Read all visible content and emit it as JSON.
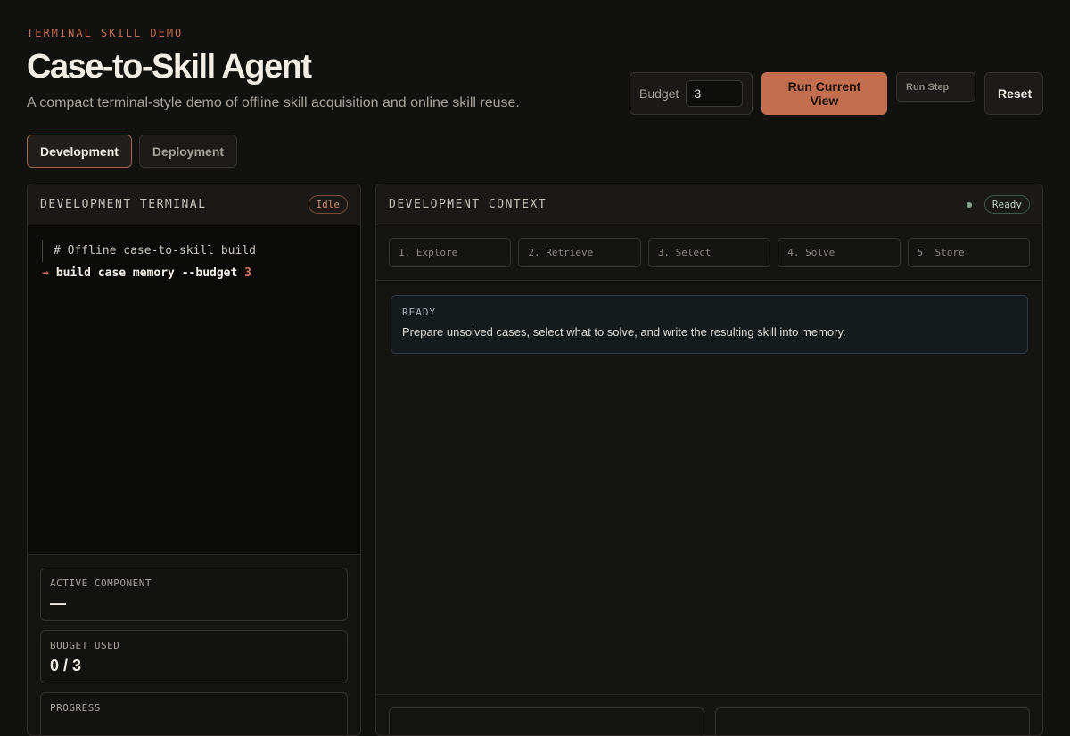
{
  "header": {
    "eyebrow": "TERMINAL SKILL DEMO",
    "title": "Case-to-Skill Agent",
    "subtitle": "A compact terminal-style demo of offline skill acquisition and online skill reuse."
  },
  "controls": {
    "budget_label": "Budget",
    "budget_value": "3",
    "run_view_label": "Run Current View",
    "run_step_label": "Run Step",
    "reset_label": "Reset"
  },
  "tabs": [
    {
      "label": "Development",
      "active": true
    },
    {
      "label": "Deployment",
      "active": false
    }
  ],
  "terminal": {
    "title": "DEVELOPMENT TERMINAL",
    "status": "Idle",
    "comment": "# Offline case-to-skill build",
    "arrow": "→",
    "command": "build case memory --budget",
    "command_arg": "3"
  },
  "stats": [
    {
      "label": "ACTIVE COMPONENT",
      "value": "—"
    },
    {
      "label": "BUDGET USED",
      "value": "0 / 3"
    },
    {
      "label": "PROGRESS",
      "value": ""
    }
  ],
  "context": {
    "title": "DEVELOPMENT CONTEXT",
    "status": "Ready",
    "steps": [
      "1. Explore",
      "2. Retrieve",
      "3. Select",
      "4. Solve",
      "5. Store"
    ],
    "card_label": "READY",
    "card_text": "Prepare unsolved cases, select what to solve, and write the resulting skill into memory."
  },
  "colors": {
    "accent": "#c36f4f",
    "background": "#111110",
    "ready_dot": "#86a58e"
  }
}
